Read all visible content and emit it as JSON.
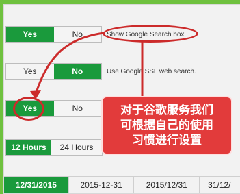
{
  "toggles": {
    "search_box": {
      "yes": "Yes",
      "no": "No",
      "description": "Show Google Search box"
    },
    "ssl": {
      "yes": "Yes",
      "no": "No",
      "description": "Use Google SSL web search."
    },
    "third": {
      "yes": "Yes",
      "no": "No"
    },
    "time_format": {
      "h12": "12 Hours",
      "h24": "24 Hours"
    }
  },
  "callout": {
    "line1": "对于谷歌服务我们",
    "line2": "可根据自己的使用",
    "line3": "习惯进行设置"
  },
  "date_formats": [
    "12/31/2015",
    "2015-12-31",
    "2015/12/31",
    "31/12/"
  ],
  "colors": {
    "accent": "#1a9a3c",
    "annotation": "#cc2b2b",
    "callout_bg": "#e23b3b",
    "frame": "#6fc13f"
  }
}
